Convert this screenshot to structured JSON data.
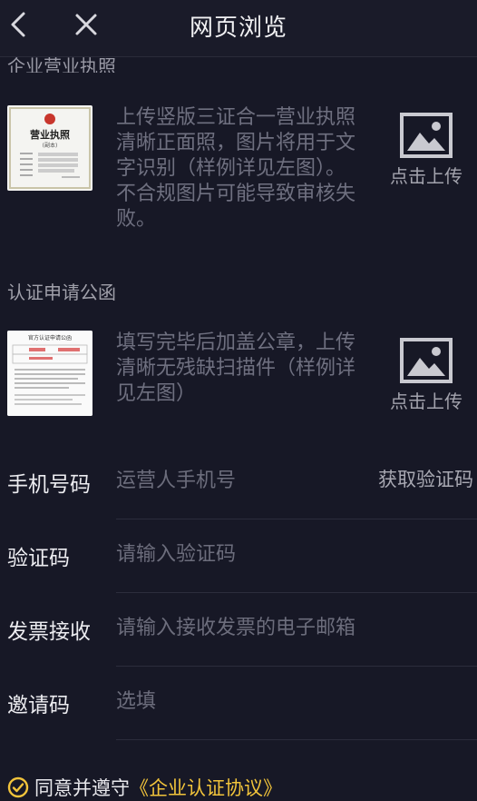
{
  "header": {
    "title": "网页浏览"
  },
  "license": {
    "section_label": "企业营业执照",
    "thumb_text": "营业执照",
    "thumb_subtext": "(副本)",
    "description": "上传竖版三证合一营业执照清晰正面照，图片将用于文字识别（样例详见左图）。不合规图片可能导致审核失败。",
    "upload_label": "点击上传"
  },
  "letter": {
    "section_label": "认证申请公函",
    "thumb_text": "官方认证申请公函",
    "description": "填写完毕后加盖公章，上传清晰无残缺扫描件（样例详见左图）",
    "upload_label": "点击上传"
  },
  "form": {
    "phone": {
      "label": "手机号码",
      "placeholder": "运营人手机号",
      "action": "获取验证码"
    },
    "code": {
      "label": "验证码",
      "placeholder": "请输入验证码"
    },
    "invoice": {
      "label": "发票接收",
      "placeholder": "请输入接收发票的电子邮箱"
    },
    "invite": {
      "label": "邀请码",
      "placeholder": "选填"
    }
  },
  "agreement": {
    "prefix": "同意并遵守",
    "link": "《企业认证协议》"
  },
  "colors": {
    "background": "#171826",
    "accent": "#f2c43b",
    "muted_text": "#6f7080"
  }
}
